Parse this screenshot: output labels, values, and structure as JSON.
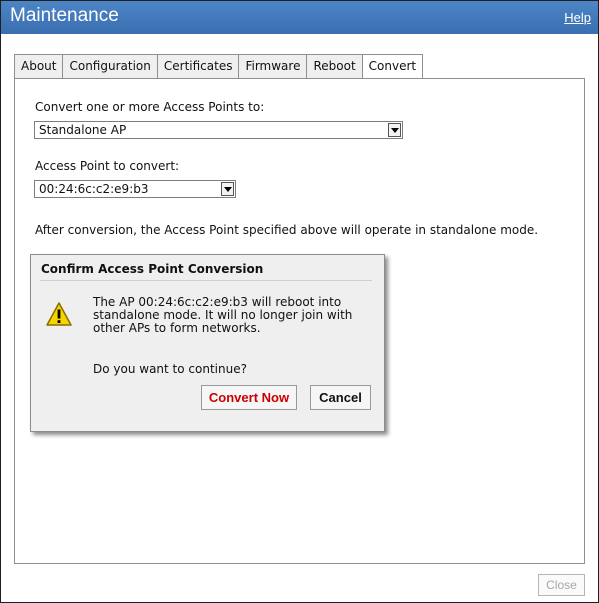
{
  "window": {
    "title": "Maintenance",
    "help": "Help"
  },
  "tabs": [
    {
      "label": "About"
    },
    {
      "label": "Configuration"
    },
    {
      "label": "Certificates"
    },
    {
      "label": "Firmware"
    },
    {
      "label": "Reboot"
    },
    {
      "label": "Convert"
    }
  ],
  "form": {
    "convert_label": "Convert one or more Access Points to:",
    "convert_value": "Standalone AP",
    "ap_label": "Access Point to convert:",
    "ap_value": "00:24:6c:c2:e9:b3",
    "note": "After conversion, the Access Point specified above will operate in standalone mode."
  },
  "dialog": {
    "title": "Confirm Access Point Conversion",
    "message_lines": [
      "The AP 00:24:6c:c2:e9:b3 will reboot into",
      "standalone mode. It will no longer join with",
      "other APs to form networks."
    ],
    "question": "Do you want to continue?",
    "convert_label": "Convert Now",
    "cancel_label": "Cancel"
  },
  "footer": {
    "close_label": "Close"
  }
}
